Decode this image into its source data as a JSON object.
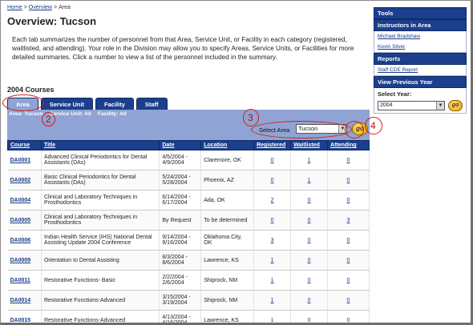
{
  "breadcrumb": {
    "home": "Home",
    "overview": "Overview",
    "current": "Area",
    "separator": ">"
  },
  "page_title": "Overview: Tucson",
  "intro": "Each tab summarizes the number of personnel from that Area, Service Unit, or Facility in each category (registered, waitlisted, and attending). Your role in the Division may allow you to specify Areas, Service Units, or Facilities for more detailed summaries. Click a number to view a list of the personnel included in the summary.",
  "courses_heading": "2004 Courses",
  "tabs": [
    "Area",
    "Service Unit",
    "Facility",
    "Staff"
  ],
  "filters": {
    "area": "Area: Tucson",
    "service_unit": "Service Unit: All",
    "facility": "Facility: All"
  },
  "select_area": {
    "label": "Select Area",
    "value": "Tucson"
  },
  "go_label": "go",
  "annotations": [
    "2",
    "3",
    "4"
  ],
  "table": {
    "headers": [
      "Course",
      "Title",
      "Date",
      "Location",
      "Registered",
      "Waitlisted",
      "Attending"
    ],
    "rows": [
      {
        "course": "DA0001",
        "title": "Advanced Clinical Periodontics for Dental Assistants (DAs)",
        "date": "4/5/2004 - 4/9/2004",
        "location": "Claremore, OK",
        "registered": "0",
        "waitlisted": "1",
        "attending": "0"
      },
      {
        "course": "DA0002",
        "title": "Basic Clinical Periodontics for Dental Assistants (DAs)",
        "date": "5/24/2004 - 5/28/2004",
        "location": "Phoenix, AZ",
        "registered": "0",
        "waitlisted": "1",
        "attending": "0"
      },
      {
        "course": "DA0004",
        "title": "Clinical and Laboratory Techniques in Prosthodontics",
        "date": "6/14/2004 - 6/17/2004",
        "location": "Ada, OK",
        "registered": "2",
        "waitlisted": "0",
        "attending": "0"
      },
      {
        "course": "DA0005",
        "title": "Clinical and Laboratory Techniques in Prosthodontics",
        "date": "By Request",
        "location": "To be determined",
        "registered": "0",
        "waitlisted": "0",
        "attending": "3"
      },
      {
        "course": "DA0006",
        "title": "Indian Health Service (IHS) National Dental Assisting Update 2004 Conference",
        "date": "9/14/2004 - 9/16/2004",
        "location": "Oklahoma City, OK",
        "registered": "3",
        "waitlisted": "0",
        "attending": "0"
      },
      {
        "course": "DA0009",
        "title": "Orientation to Dental Assisting",
        "date": "8/3/2004 - 8/6/2004",
        "location": "Lawrence, KS",
        "registered": "1",
        "waitlisted": "0",
        "attending": "0"
      },
      {
        "course": "DA0011",
        "title": "Restorative Functions- Basic",
        "date": "2/2/2004 - 2/6/2004",
        "location": "Shiprock, NM",
        "registered": "1",
        "waitlisted": "0",
        "attending": "0"
      },
      {
        "course": "DA0014",
        "title": "Restorative Functions-Advanced",
        "date": "3/15/2004 - 3/19/2004",
        "location": "Shiprock, NM",
        "registered": "1",
        "waitlisted": "0",
        "attending": "0"
      },
      {
        "course": "DA0015",
        "title": "Restorative Functions-Advanced",
        "date": "4/13/2004 - 4/16/2004",
        "location": "Lawrence, KS",
        "registered": "1",
        "waitlisted": "0",
        "attending": "0"
      }
    ]
  },
  "sidebar": {
    "tools": "Tools",
    "instructors_heading": "Instructors in Area",
    "instructors": [
      "Michael Bradshaw",
      "Kevin Silver"
    ],
    "reports_heading": "Reports",
    "reports": [
      "Staff CDE Report"
    ],
    "previous_year_heading": "View Previous Year",
    "select_year_label": "Select Year:",
    "year_value": "2004",
    "go_label": "go"
  },
  "colors": {
    "header_blue": "#1b3f8c",
    "band_blue": "#8fa4d4",
    "annotation_red": "#d41a1a",
    "link": "#1a3a8a"
  }
}
